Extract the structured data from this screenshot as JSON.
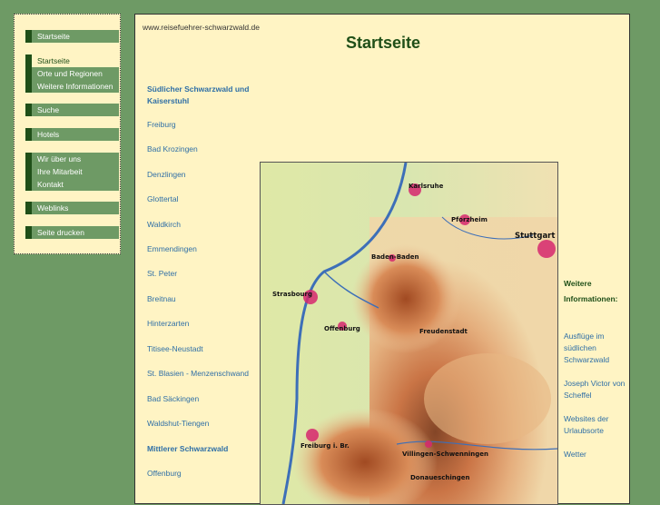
{
  "sidebar": {
    "groups": [
      {
        "items": [
          "Startseite"
        ]
      },
      {
        "items": [
          "Startseite",
          "Orte und Regionen",
          "Weitere Informationen"
        ]
      },
      {
        "items": [
          "Suche"
        ]
      },
      {
        "items": [
          "Hotels"
        ]
      },
      {
        "items": [
          "Wir über uns",
          "Ihre Mitarbeit",
          "Kontakt"
        ]
      },
      {
        "items": [
          "Weblinks"
        ]
      },
      {
        "items": [
          "Seite drucken"
        ]
      }
    ]
  },
  "main": {
    "url": "www.reisefuehrer-schwarzwald.de",
    "title": "Startseite",
    "locations": [
      "Südlicher Schwarzwald und Kaiserstuhl",
      "Freiburg",
      "Bad Krozingen",
      "Denzlingen",
      "Glottertal",
      "Waldkirch",
      "Emmendingen",
      "St. Peter",
      "Breitnau",
      "Hinterzarten",
      "Titisee-Neustadt",
      "St. Blasien - Menzenschwand",
      "Bad Säckingen",
      "Waldshut-Tiengen",
      "Mittlerer Schwarzwald",
      "Offenburg"
    ],
    "map_labels": [
      "Karlsruhe",
      "Pforzheim",
      "Stuttgart",
      "Baden-Baden",
      "Strasbourg",
      "Offenburg",
      "Freudenstadt",
      "Freiburg i. Br.",
      "Villingen-Schwenningen",
      "Donaueschingen"
    ],
    "info": {
      "heading": "Weitere Informationen:",
      "links": [
        "Ausflüge im südlichen Schwarzwald",
        "Joseph Victor von Scheffel",
        "Websites der Urlaubsorte",
        "Wetter"
      ]
    }
  }
}
